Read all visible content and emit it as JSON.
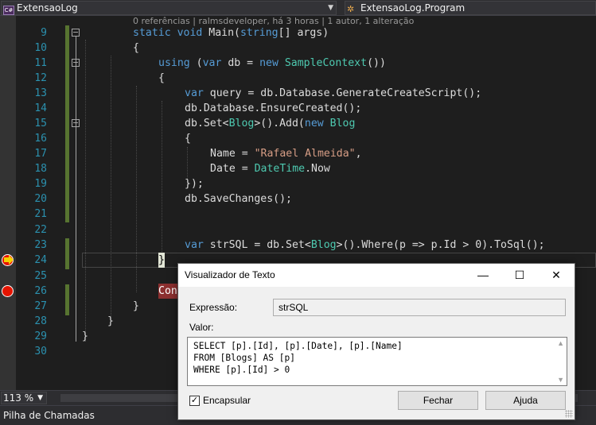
{
  "navbar": {
    "project": "ExtensaoLog",
    "class": "ExtensaoLog.Program"
  },
  "codelens": "0 referências | ralmsdeveloper, há 3 horas | 1 autor, 1 alteração",
  "lines": [
    "9",
    "10",
    "11",
    "12",
    "13",
    "14",
    "15",
    "16",
    "17",
    "18",
    "19",
    "20",
    "21",
    "22",
    "23",
    "24",
    "25",
    "26",
    "27",
    "28",
    "29",
    "30"
  ],
  "code": {
    "l9a": "static void ",
    "l9b": "Main(",
    "l9c": "string",
    "l9d": "[] args)",
    "l10": "{",
    "l11a": "using",
    "l11b": " (",
    "l11c": "var",
    "l11d": " db = ",
    "l11e": "new",
    "l11f": " ",
    "l11g": "SampleContext",
    "l11h": "())",
    "l12": "{",
    "l13a": "var",
    "l13b": " query = db.Database.GenerateCreateScript();",
    "l14": "db.Database.EnsureCreated();",
    "l15a": "db.Set<",
    "l15b": "Blog",
    "l15c": ">().Add(",
    "l15d": "new",
    "l15e": " ",
    "l15f": "Blog",
    "l16": "{",
    "l17a": "Name = ",
    "l17b": "\"Rafael Almeida\"",
    "l17c": ",",
    "l18a": "Date = ",
    "l18b": "DateTime",
    "l18c": ".Now",
    "l19": "});",
    "l20": "db.SaveChanges();",
    "l23a": "var",
    "l23b": " strSQL = db.Set<",
    "l23c": "Blog",
    "l23d": ">().Where(p => p.Id > 0).ToSql();",
    "l24": "}",
    "l26": "Con",
    "l27": "}",
    "l28": "}",
    "l29": "}"
  },
  "zoom": "113 %",
  "bottom_panel": "Pilha de Chamadas",
  "dialog": {
    "title": "Visualizador de Texto",
    "minimize": "—",
    "maximize": "☐",
    "close": "✕",
    "expr_label": "Expressão:",
    "expr_value": "strSQL",
    "value_label": "Valor:",
    "value_lines": [
      "SELECT [p].[Id], [p].[Date], [p].[Name]",
      "FROM [Blogs] AS [p]",
      "WHERE [p].[Id] > 0"
    ],
    "wrap_label": "Encapsular",
    "wrap_checked": "✓",
    "close_button": "Fechar",
    "help_button": "Ajuda"
  }
}
